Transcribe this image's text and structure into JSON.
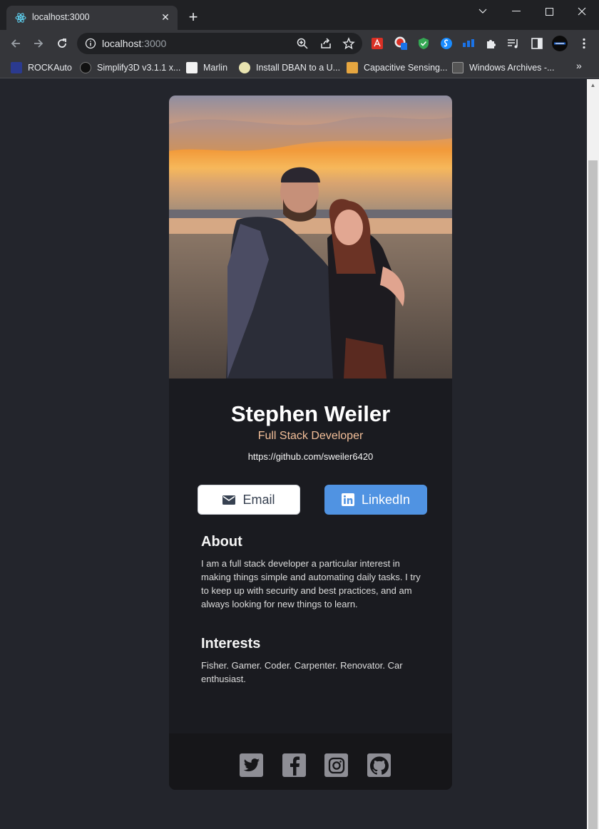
{
  "browser": {
    "tab_title": "localhost:3000",
    "url_host": "localhost",
    "url_port": ":3000",
    "bookmarks": [
      {
        "label": "ROCKAuto"
      },
      {
        "label": "Simplify3D v3.1.1 x..."
      },
      {
        "label": "Marlin"
      },
      {
        "label": "Install DBAN to a U..."
      },
      {
        "label": "Capacitive Sensing..."
      },
      {
        "label": "Windows Archives -..."
      }
    ]
  },
  "profile": {
    "photo_alt": "Couple posing on a beach at sunset",
    "name": "Stephen Weiler",
    "role": "Full Stack Developer",
    "website": "https://github.com/sweiler6420"
  },
  "buttons": {
    "email": "Email",
    "linkedin": "LinkedIn"
  },
  "about": {
    "title": "About",
    "text": "I am a full stack developer a particular interest in making things simple and automating daily tasks. I try to keep up with security and best practices, and am always looking for new things to learn."
  },
  "interests": {
    "title": "Interests",
    "text": "Fisher. Gamer. Coder. Carpenter. Renovator. Car enthusiast."
  },
  "footer": {
    "social_icons": [
      "twitter-icon",
      "facebook-icon",
      "instagram-icon",
      "github-icon"
    ]
  },
  "colors": {
    "page_bg": "#23252c",
    "card_bg": "#1a1b20",
    "accent": "#f3bf99",
    "linkedin": "#5093e2"
  }
}
